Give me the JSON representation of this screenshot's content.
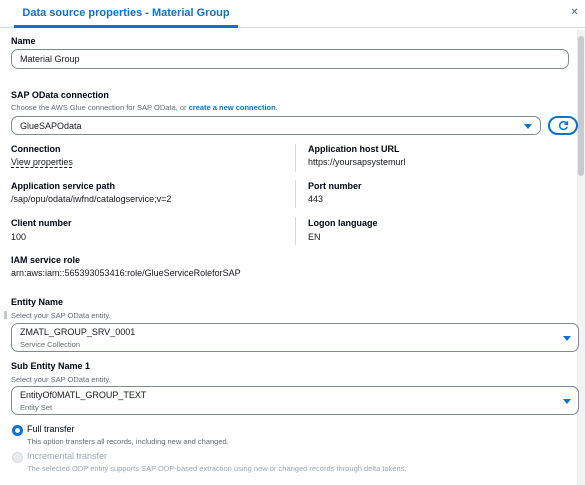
{
  "panel": {
    "tab_title": "Data source properties - Material Group"
  },
  "name_field": {
    "label": "Name",
    "value": "Material Group"
  },
  "odata_connection": {
    "label": "SAP OData connection",
    "description_prefix": "Choose the AWS Glue connection for SAP OData, or ",
    "create_link": "create a new connection",
    "description_suffix": ".",
    "selected": "GlueSAPOdata"
  },
  "details": {
    "connection_label": "Connection",
    "connection_link": "View properties",
    "app_host_label": "Application host URL",
    "app_host_value": "https://yoursapsystemurl",
    "service_path_label": "Application service path",
    "service_path_value": "/sap/opu/odata/iwfnd/catalogservice;v=2",
    "port_label": "Port number",
    "port_value": "443",
    "client_label": "Client number",
    "client_value": "100",
    "logon_label": "Logon language",
    "logon_value": "EN",
    "iam_label": "IAM service role",
    "iam_value": "arn:aws:iam::565393053416:role/GlueServiceRoleforSAP"
  },
  "entity": {
    "label": "Entity Name",
    "description": "Select your SAP OData entity.",
    "selected": "ZMATL_GROUP_SRV_0001",
    "selected_sub": "Service Collection"
  },
  "sub_entity": {
    "label": "Sub Entity Name 1",
    "description": "Select your SAP OData entity.",
    "selected": "EntityOf0MATL_GROUP_TEXT",
    "selected_sub": "Entity Set"
  },
  "transfer": {
    "full_label": "Full transfer",
    "full_desc": "This option transfers all records, including new and changed.",
    "full_selected": true,
    "incremental_label": "Incremental transfer",
    "incremental_desc": "The selected ODP entity supports SAP ODP-based extraction using new or changed records through delta tokens.",
    "incremental_enabled": false
  },
  "colors": {
    "accent": "#0972d3",
    "text": "#000716",
    "muted": "#5f6b7a",
    "border": "#7d8998",
    "disabled": "#9ba7b6"
  },
  "icons": [
    "close-icon",
    "caret-down-icon",
    "refresh-icon",
    "radio-checked-icon",
    "radio-unchecked-icon"
  ]
}
